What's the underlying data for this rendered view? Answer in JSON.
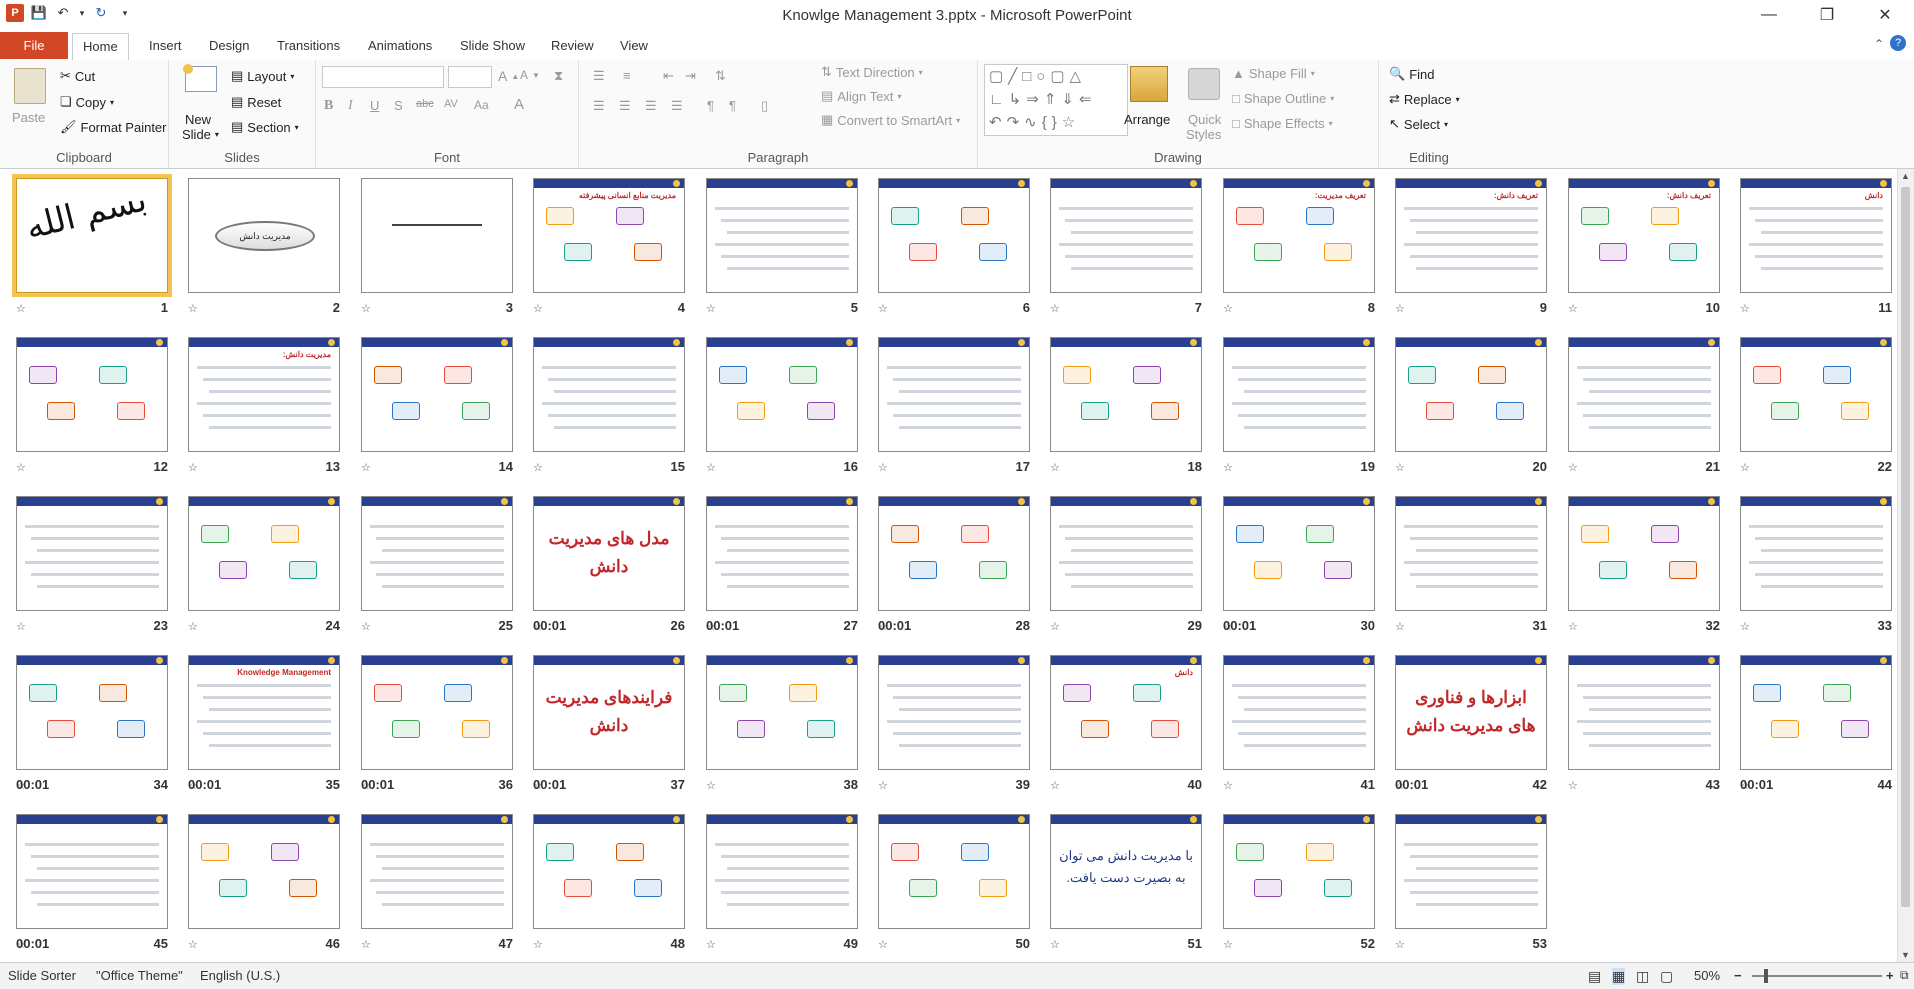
{
  "window": {
    "title": "Knowlge Management 3.pptx  -  Microsoft PowerPoint"
  },
  "tabs": [
    "File",
    "Home",
    "Insert",
    "Design",
    "Transitions",
    "Animations",
    "Slide Show",
    "Review",
    "View"
  ],
  "ribbon": {
    "clipboard": {
      "label": "Clipboard",
      "paste": "Paste",
      "cut": "Cut",
      "copy": "Copy",
      "format_painter": "Format Painter"
    },
    "slides": {
      "label": "Slides",
      "new_slide_1": "New",
      "new_slide_2": "Slide",
      "layout": "Layout",
      "reset": "Reset",
      "section": "Section"
    },
    "font": {
      "label": "Font"
    },
    "paragraph": {
      "label": "Paragraph",
      "text_direction": "Text Direction",
      "align_text": "Align Text",
      "convert_smartart": "Convert to SmartArt"
    },
    "drawing": {
      "label": "Drawing",
      "arrange": "Arrange",
      "quick_styles_1": "Quick",
      "quick_styles_2": "Styles",
      "shape_fill": "Shape Fill",
      "shape_outline": "Shape Outline",
      "shape_effects": "Shape Effects"
    },
    "editing": {
      "label": "Editing",
      "find": "Find",
      "replace": "Replace",
      "select": "Select"
    }
  },
  "slides": [
    {
      "num": "1",
      "time": "",
      "text": ""
    },
    {
      "num": "2",
      "time": "",
      "text": "مدیریت دانش"
    },
    {
      "num": "3",
      "time": "",
      "text": ""
    },
    {
      "num": "4",
      "time": "",
      "text": "مدیریت منابع انسانی پیشرفته"
    },
    {
      "num": "5",
      "time": "",
      "text": ""
    },
    {
      "num": "6",
      "time": "",
      "text": ""
    },
    {
      "num": "7",
      "time": "",
      "text": ""
    },
    {
      "num": "8",
      "time": "",
      "text": "تعریف مدیریت:"
    },
    {
      "num": "9",
      "time": "",
      "text": "تعریف دانش:"
    },
    {
      "num": "10",
      "time": "",
      "text": "تعریف دانش:"
    },
    {
      "num": "11",
      "time": "",
      "text": "دانش"
    },
    {
      "num": "12",
      "time": "",
      "text": ""
    },
    {
      "num": "13",
      "time": "",
      "text": "مدیریت دانش:"
    },
    {
      "num": "14",
      "time": "",
      "text": ""
    },
    {
      "num": "15",
      "time": "",
      "text": ""
    },
    {
      "num": "16",
      "time": "",
      "text": ""
    },
    {
      "num": "17",
      "time": "",
      "text": ""
    },
    {
      "num": "18",
      "time": "",
      "text": ""
    },
    {
      "num": "19",
      "time": "",
      "text": ""
    },
    {
      "num": "20",
      "time": "",
      "text": ""
    },
    {
      "num": "21",
      "time": "",
      "text": ""
    },
    {
      "num": "22",
      "time": "",
      "text": ""
    },
    {
      "num": "23",
      "time": "",
      "text": ""
    },
    {
      "num": "24",
      "time": "",
      "text": ""
    },
    {
      "num": "25",
      "time": "",
      "text": ""
    },
    {
      "num": "26",
      "time": "00:01",
      "text": "مدل های مدیریت دانش"
    },
    {
      "num": "27",
      "time": "00:01",
      "text": ""
    },
    {
      "num": "28",
      "time": "00:01",
      "text": ""
    },
    {
      "num": "29",
      "time": "",
      "text": ""
    },
    {
      "num": "30",
      "time": "00:01",
      "text": ""
    },
    {
      "num": "31",
      "time": "",
      "text": ""
    },
    {
      "num": "32",
      "time": "",
      "text": ""
    },
    {
      "num": "33",
      "time": "",
      "text": ""
    },
    {
      "num": "34",
      "time": "00:01",
      "text": ""
    },
    {
      "num": "35",
      "time": "00:01",
      "text": "Knowledge Management"
    },
    {
      "num": "36",
      "time": "00:01",
      "text": ""
    },
    {
      "num": "37",
      "time": "00:01",
      "text": "فرایندهای مدیریت دانش"
    },
    {
      "num": "38",
      "time": "",
      "text": ""
    },
    {
      "num": "39",
      "time": "",
      "text": ""
    },
    {
      "num": "40",
      "time": "",
      "text": "دانش"
    },
    {
      "num": "41",
      "time": "",
      "text": ""
    },
    {
      "num": "42",
      "time": "00:01",
      "text": "ابزارها و فناوری های مدیریت دانش"
    },
    {
      "num": "43",
      "time": "",
      "text": ""
    },
    {
      "num": "44",
      "time": "00:01",
      "text": ""
    },
    {
      "num": "45",
      "time": "00:01",
      "text": ""
    },
    {
      "num": "46",
      "time": "",
      "text": ""
    },
    {
      "num": "47",
      "time": "",
      "text": ""
    },
    {
      "num": "48",
      "time": "",
      "text": ""
    },
    {
      "num": "49",
      "time": "",
      "text": ""
    },
    {
      "num": "50",
      "time": "",
      "text": ""
    },
    {
      "num": "51",
      "time": "",
      "text": "با مدیریت دانش می توان به بصیرت دست یافت."
    },
    {
      "num": "52",
      "time": "",
      "text": ""
    },
    {
      "num": "53",
      "time": "",
      "text": ""
    }
  ],
  "status": {
    "view": "Slide Sorter",
    "theme": "\"Office Theme\"",
    "language": "English (U.S.)",
    "zoom": "50%"
  }
}
